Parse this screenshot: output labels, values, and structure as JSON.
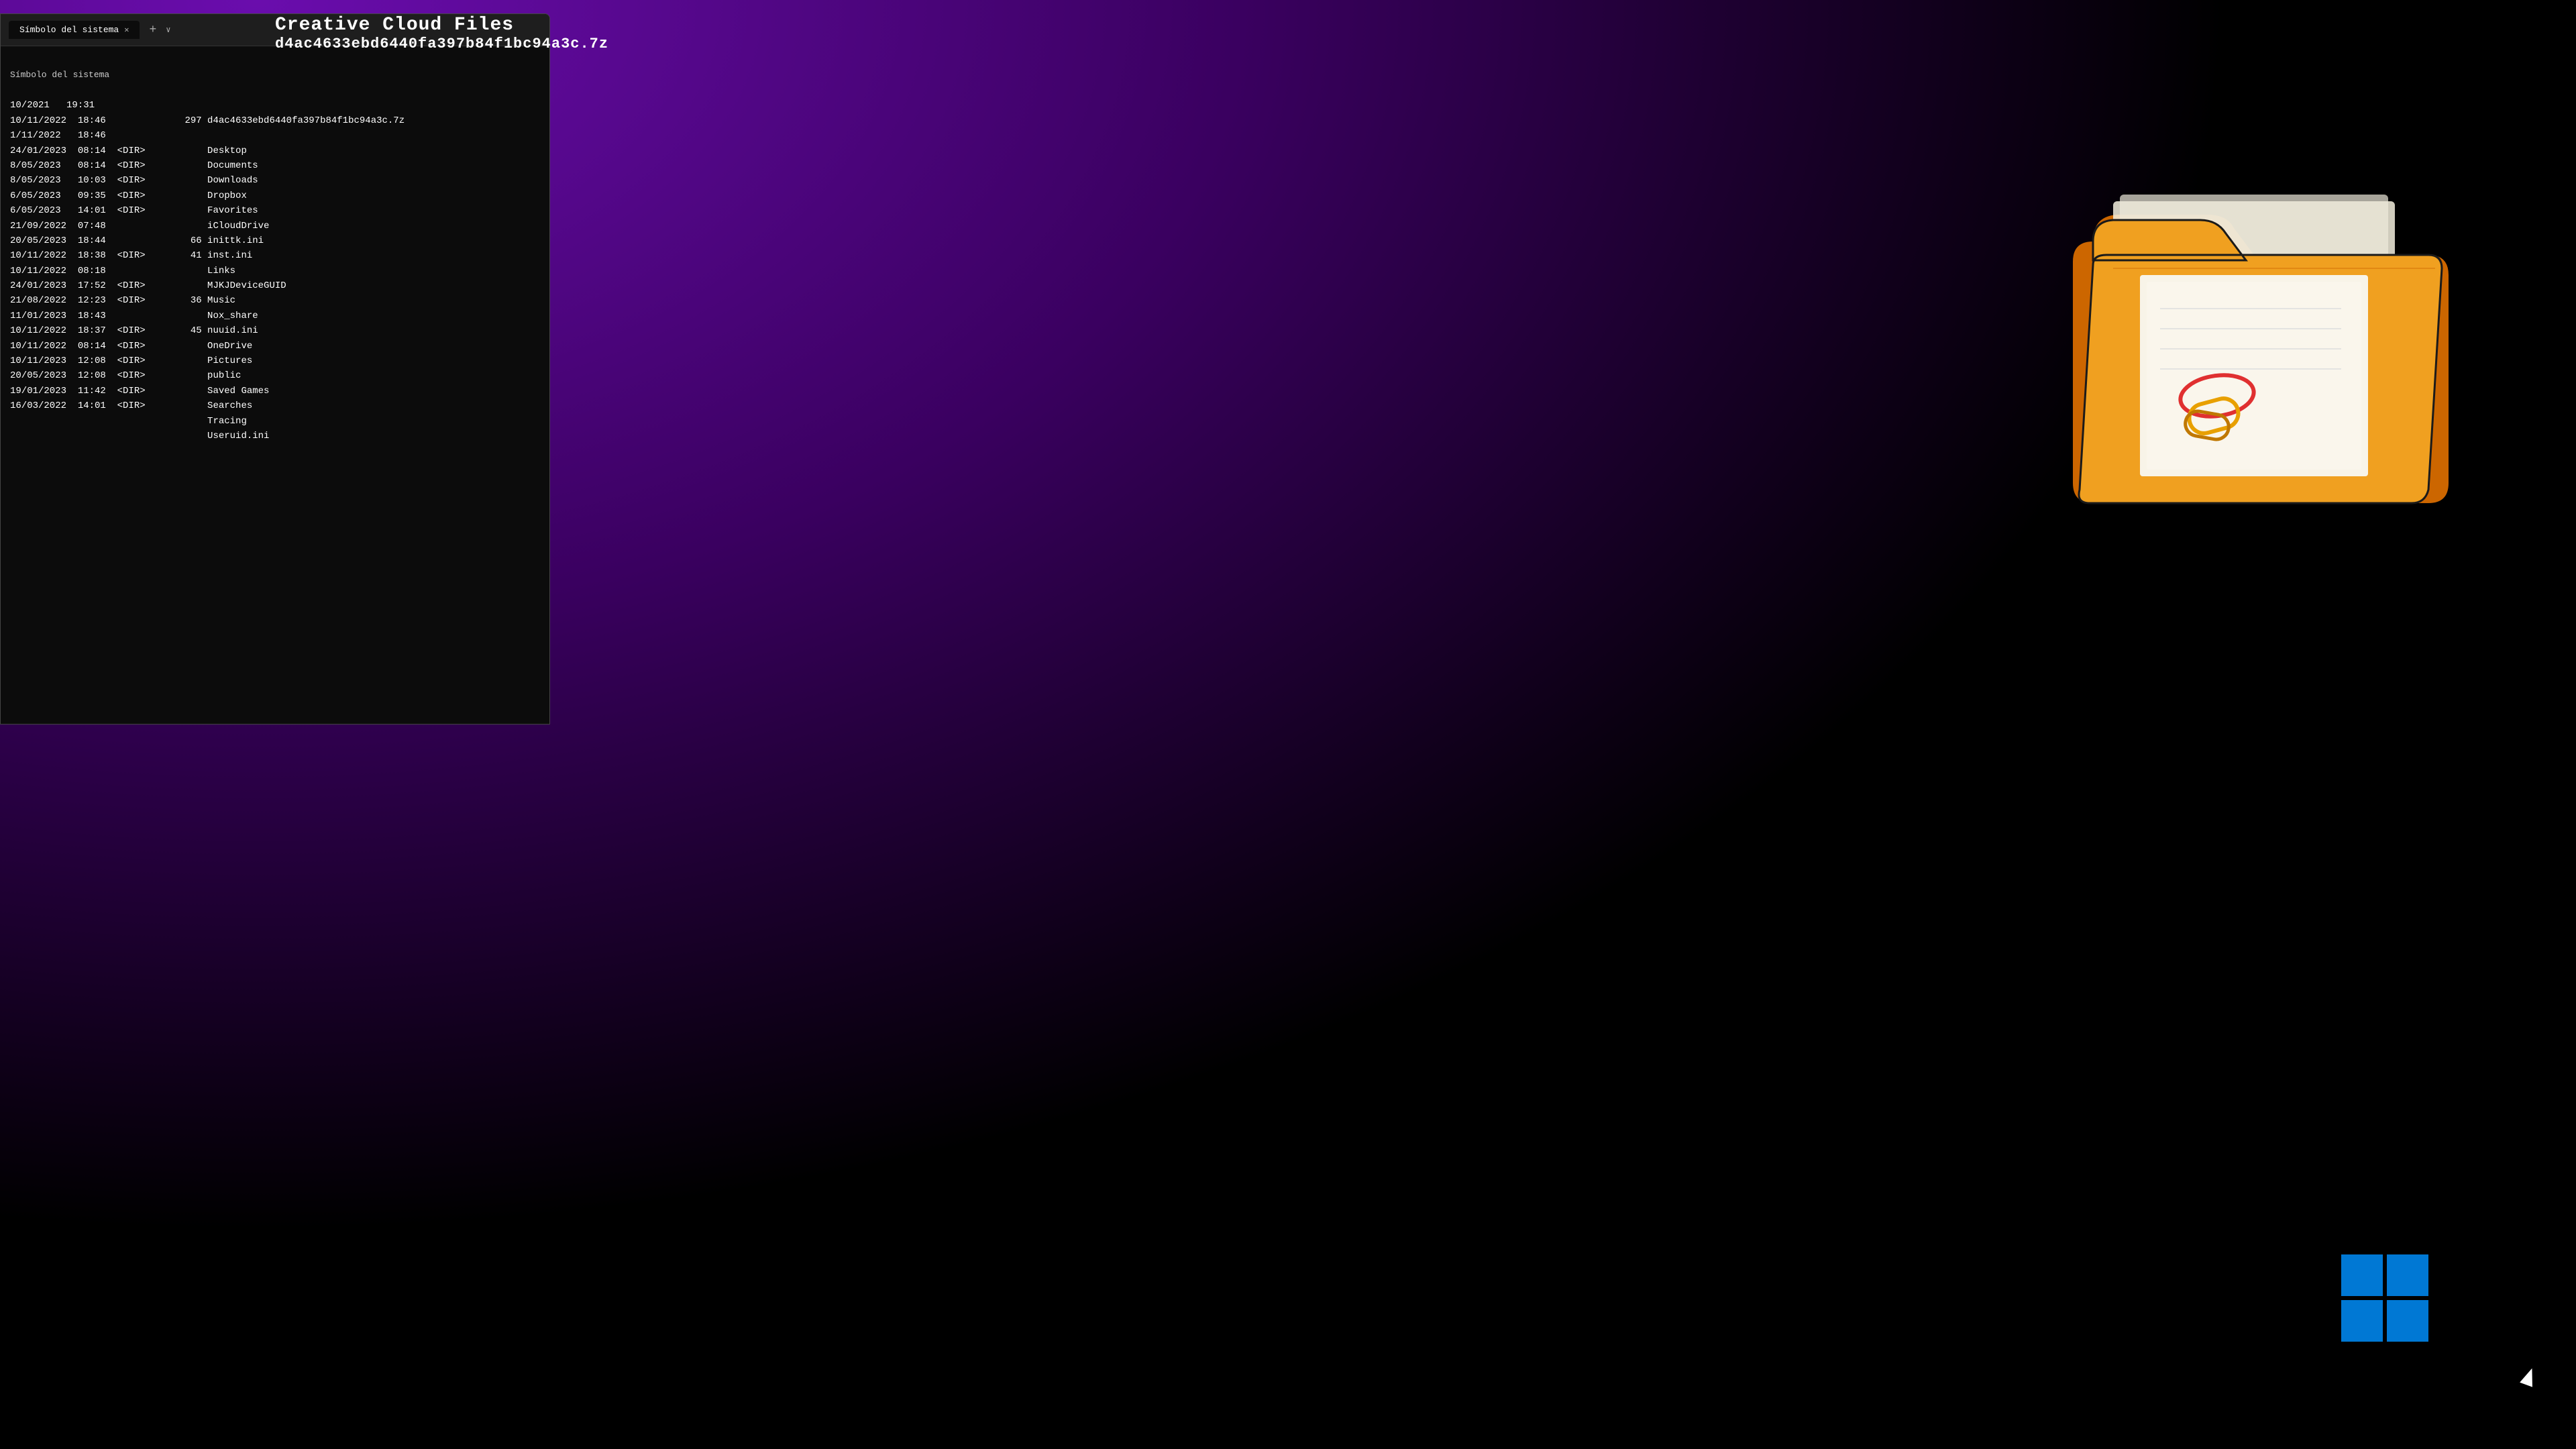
{
  "background": {
    "gradient_description": "purple-to-black radial from top-left"
  },
  "terminal": {
    "title": "Símbolo del sistema",
    "tab_close": "✕",
    "tab_new": "+",
    "tab_dropdown": "∨",
    "header_line1": "Creative Cloud Files",
    "header_line2": "d4ac4633ebd6440fa397b84f1bc94a3c.7z",
    "directory_entries": [
      {
        "date": "10/2021",
        "time": "19:31",
        "type": "",
        "size": "",
        "name": ""
      },
      {
        "date": "10/11/2022",
        "time": "18:46",
        "type": "",
        "size": "297",
        "name": "d4ac4633ebd6440fa397b84f1bc94a3c.7z"
      },
      {
        "date": "1/11/2022",
        "time": "18:46",
        "type": "",
        "size": "",
        "name": ""
      },
      {
        "date": "24/01/2023",
        "time": "08:14",
        "type": "<DIR>",
        "size": "",
        "name": "Desktop"
      },
      {
        "date": "8/05/2023",
        "time": "08:14",
        "type": "<DIR>",
        "size": "",
        "name": "Documents"
      },
      {
        "date": "8/05/2023",
        "time": "10:03",
        "type": "<DIR>",
        "size": "",
        "name": "Downloads"
      },
      {
        "date": "6/05/2023",
        "time": "09:35",
        "type": "<DIR>",
        "size": "",
        "name": "Dropbox"
      },
      {
        "date": "6/05/2023",
        "time": "14:01",
        "type": "<DIR>",
        "size": "",
        "name": "Favorites"
      },
      {
        "date": "21/09/2022",
        "time": "07:48",
        "type": "",
        "size": "",
        "name": "iCloudDrive"
      },
      {
        "date": "20/05/2023",
        "time": "18:44",
        "type": "",
        "size": "66",
        "name": "inittk.ini"
      },
      {
        "date": "10/11/2022",
        "time": "18:38",
        "type": "<DIR>",
        "size": "41",
        "name": "inst.ini"
      },
      {
        "date": "10/11/2022",
        "time": "08:18",
        "type": "",
        "size": "",
        "name": "Links"
      },
      {
        "date": "24/01/2023",
        "time": "17:52",
        "type": "<DIR>",
        "size": "",
        "name": "MJKJDeviceGUID"
      },
      {
        "date": "21/08/2022",
        "time": "12:23",
        "type": "<DIR>",
        "size": "36",
        "name": "Music"
      },
      {
        "date": "11/01/2023",
        "time": "18:43",
        "type": "",
        "size": "",
        "name": "Nox_share"
      },
      {
        "date": "10/11/2022",
        "time": "18:37",
        "type": "<DIR>",
        "size": "45",
        "name": "nuuid.ini"
      },
      {
        "date": "10/11/2022",
        "time": "08:14",
        "type": "<DIR>",
        "size": "",
        "name": "OneDrive"
      },
      {
        "date": "10/11/2023",
        "time": "12:08",
        "type": "<DIR>",
        "size": "",
        "name": "Pictures"
      },
      {
        "date": "20/05/2023",
        "time": "12:08",
        "type": "<DIR>",
        "size": "",
        "name": "public"
      },
      {
        "date": "19/01/2023",
        "time": "11:42",
        "type": "<DIR>",
        "size": "",
        "name": "Saved Games"
      },
      {
        "date": "16/03/2022",
        "time": "14:01",
        "type": "<DIR>",
        "size": "",
        "name": "Searches"
      },
      {
        "date": "",
        "time": "",
        "type": "",
        "size": "",
        "name": "Tracing"
      },
      {
        "date": "",
        "time": "",
        "type": "",
        "size": "",
        "name": "Useruid.ini"
      }
    ]
  },
  "folder_illustration": {
    "description": "Open manila folder with papers, orange/yellow color",
    "accent_color": "#e8870a",
    "folder_dark": "#cc6600",
    "paper_color": "#f5f0e0"
  },
  "windows_logo": {
    "color": "#0078d4",
    "description": "Windows 11 4-square logo"
  },
  "cursor": {
    "color": "#ffffff"
  },
  "searches_label": "Searches"
}
